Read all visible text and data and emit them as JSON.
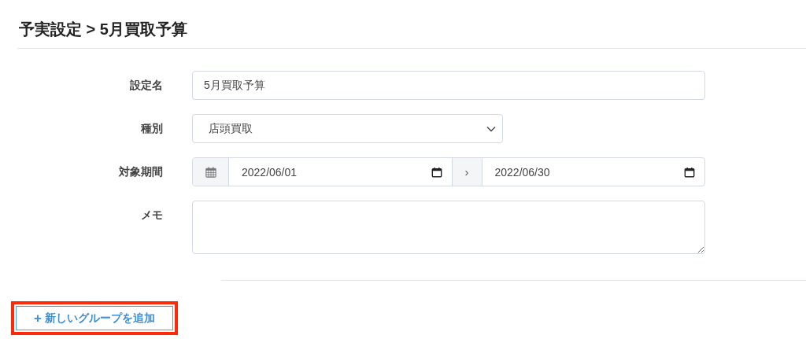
{
  "title": "予実設定 > 5月買取予算",
  "form": [
    {
      "kind": "text",
      "label": "設定名",
      "value": "5月買取予算"
    },
    {
      "kind": "select",
      "label": "種別",
      "value": "店頭買取"
    },
    {
      "kind": "daterange",
      "label": "対象期間",
      "start": "2022/06/01",
      "separator": "›",
      "end": "2022/06/30"
    },
    {
      "kind": "textarea",
      "label": "メモ"
    }
  ],
  "add_group_button": {
    "icon": "+",
    "label": "新しいグループを追加",
    "highlighted": true
  }
}
